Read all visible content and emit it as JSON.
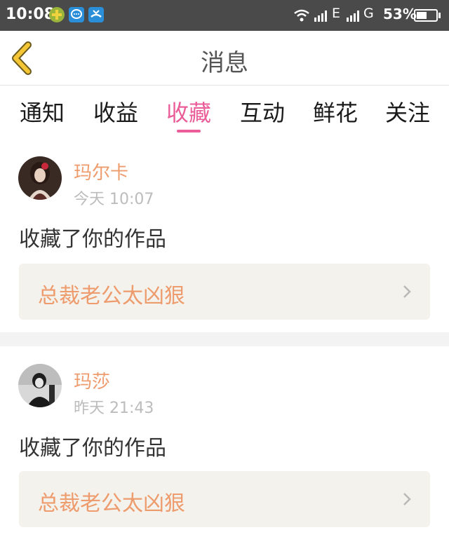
{
  "status_bar": {
    "time": "10:08",
    "network_1": "E",
    "network_2": "G",
    "battery": "53%",
    "battery_level": 0.53,
    "icons": [
      "app-plus-icon",
      "chat-bubble-icon",
      "missed-call-icon",
      "wifi-icon",
      "signal-icon",
      "battery-icon"
    ]
  },
  "header": {
    "title": "消息",
    "back_icon": "chevron-left-icon"
  },
  "tabs": [
    {
      "label": "通知",
      "active": false
    },
    {
      "label": "收益",
      "active": false
    },
    {
      "label": "收藏",
      "active": true
    },
    {
      "label": "互动",
      "active": false
    },
    {
      "label": "鲜花",
      "active": false
    },
    {
      "label": "关注",
      "active": false
    }
  ],
  "notifications": [
    {
      "user": "玛尔卡",
      "time": "今天 10:07",
      "action": "收藏了你的作品",
      "work_title": "总裁老公太凶狠",
      "avatar": "avatar-red-hair-girl"
    },
    {
      "user": "玛莎",
      "time": "昨天 21:43",
      "action": "收藏了你的作品",
      "work_title": "总裁老公太凶狠",
      "avatar": "avatar-dark-figure"
    }
  ],
  "colors": {
    "accent_pink": "#ea5d99",
    "username_orange": "#ee9b6d",
    "back_yellow": "#f4c534",
    "status_bar": "#4a4a4a",
    "card_box": "#f3f2ec"
  }
}
